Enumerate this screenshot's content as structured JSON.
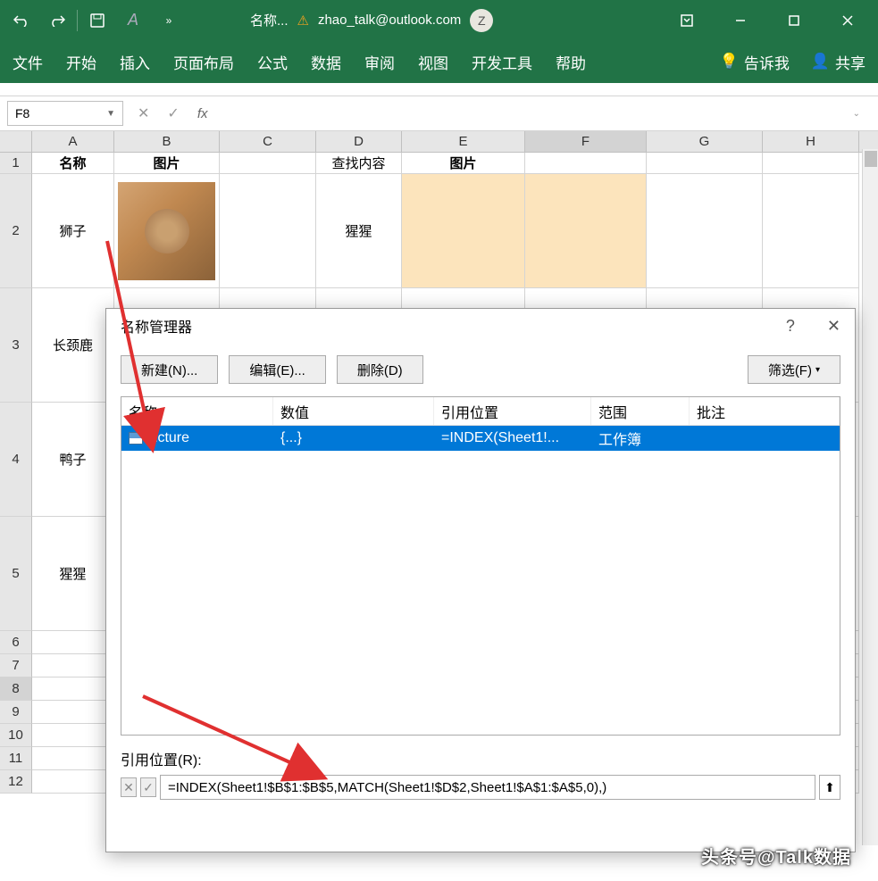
{
  "titlebar": {
    "doc_title": "名称...",
    "user_email": "zhao_talk@outlook.com",
    "user_initial": "Z"
  },
  "ribbon": {
    "file": "文件",
    "home": "开始",
    "insert": "插入",
    "layout": "页面布局",
    "formulas": "公式",
    "data": "数据",
    "review": "审阅",
    "view": "视图",
    "dev": "开发工具",
    "help": "帮助",
    "tell_me": "告诉我",
    "share": "共享"
  },
  "formula_bar": {
    "name_box": "F8",
    "formula": ""
  },
  "columns": [
    "A",
    "B",
    "C",
    "D",
    "E",
    "F",
    "G",
    "H"
  ],
  "rows": [
    "1",
    "2",
    "3",
    "4",
    "5",
    "6",
    "7",
    "8",
    "9",
    "10",
    "11",
    "12"
  ],
  "cells": {
    "row1": {
      "A": "名称",
      "B": "图片",
      "D": "查找内容",
      "E": "图片"
    },
    "row2": {
      "A": "狮子",
      "D": "猩猩"
    },
    "row3": {
      "A": "长颈鹿"
    },
    "row4": {
      "A": "鸭子"
    },
    "row5": {
      "A": "猩猩"
    }
  },
  "dialog": {
    "title": "名称管理器",
    "new_btn": "新建(N)...",
    "edit_btn": "编辑(E)...",
    "delete_btn": "删除(D)",
    "filter_btn": "筛选(F)",
    "headers": {
      "name": "名称",
      "value": "数值",
      "refers": "引用位置",
      "scope": "范围",
      "comment": "批注"
    },
    "row": {
      "name": "picture",
      "value": "{...}",
      "refers": "=INDEX(Sheet1!...",
      "scope": "工作簿",
      "comment": ""
    },
    "ref_label": "引用位置(R):",
    "ref_formula": "=INDEX(Sheet1!$B$1:$B$5,MATCH(Sheet1!$D$2,Sheet1!$A$1:$A$5,0),)"
  },
  "watermark": "头条号@Talk数据"
}
